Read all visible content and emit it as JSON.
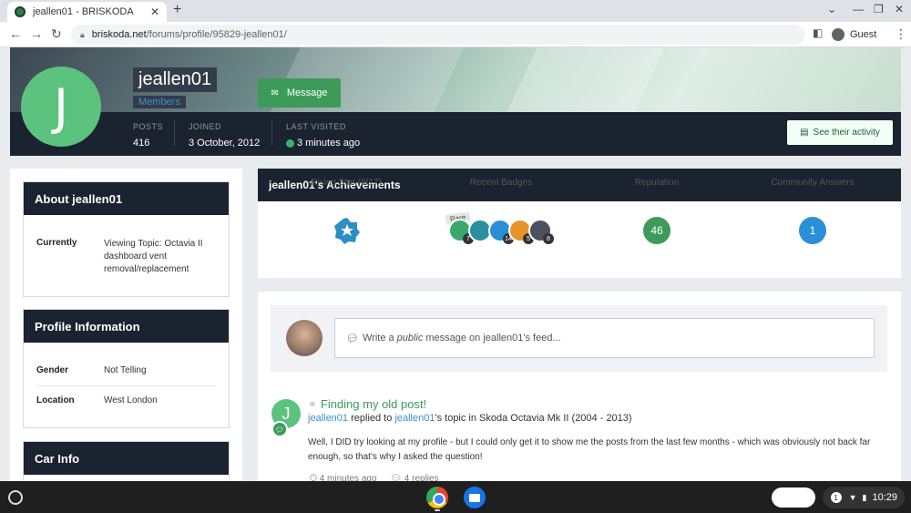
{
  "browser": {
    "tab_title": "jeallen01 - BRISKODA",
    "tab_close": "✕",
    "new_tab": "+",
    "url_host": "briskoda.net",
    "url_path": "/forums/profile/95829-jeallen01/",
    "profile_label": "Guest",
    "nav_back": "←",
    "nav_forward": "→",
    "nav_reload": "↻"
  },
  "profile": {
    "avatar_letter": "J",
    "username": "jeallen01",
    "group": "Members",
    "message_button": "Message",
    "activity_button": "See their activity",
    "stats": [
      {
        "label": "POSTS",
        "value": "416"
      },
      {
        "label": "JOINED",
        "value": "3 October, 2012"
      },
      {
        "label": "LAST VISITED",
        "value": "3 minutes ago"
      }
    ]
  },
  "sidebar": {
    "about": {
      "title": "About jeallen01",
      "currently_label": "Currently",
      "currently_line1": "Viewing Topic: Octavia II",
      "currently_line2": "dashboard vent",
      "currently_line3": "removal/replacement"
    },
    "profile_info": {
      "title": "Profile Information",
      "gender_label": "Gender",
      "gender_value": "Not Telling",
      "location_label": "Location",
      "location_value": "West London"
    },
    "car_info": {
      "title": "Car Info"
    }
  },
  "achievements": {
    "title": "jeallen01's Achievements",
    "rank_label": "Rising Star (9/17)",
    "badges_label": "Recent Badges",
    "rare_tag": "Rare",
    "badge_counts": [
      "7",
      "",
      "14",
      "5",
      "8"
    ],
    "reputation_value": "46",
    "reputation_label": "Reputation",
    "answers_value": "1",
    "answers_label": "Community Answers"
  },
  "feed": {
    "composer_prefix": "Write a",
    "composer_em": "public",
    "composer_suffix": "message on jeallen01's feed...",
    "post": {
      "avatar_letter": "J",
      "title": "Finding my old post!",
      "author": "jeallen01",
      "action": "replied to",
      "target_user": "jeallen01",
      "target_suffix": "'s topic in Skoda Octavia Mk II (2004 - 2013)",
      "body": "Well, I DID try looking at my profile - but I could only get it to show me the posts from the last few months - which was obviously not back far enough, so that's why I asked the question!",
      "time": "4 minutes ago",
      "replies": "4 replies"
    }
  },
  "shelf": {
    "notification_count": "1",
    "clock": "10:29"
  },
  "colors": {
    "accent_green": "#3d9b5a",
    "dark_header": "#1c2330",
    "link_blue": "#3a8fd6"
  }
}
